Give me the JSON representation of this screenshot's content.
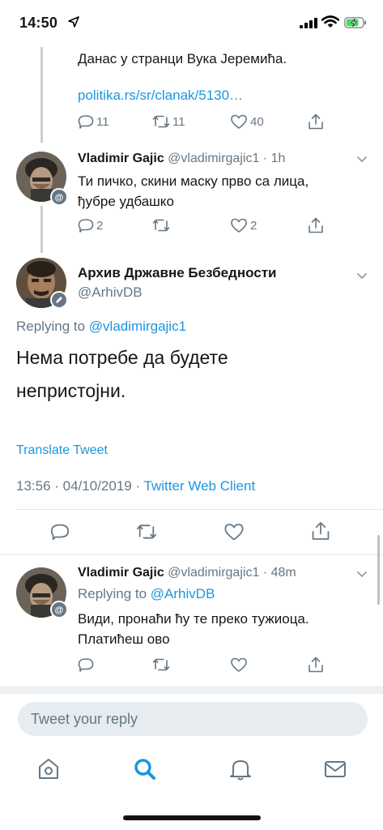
{
  "status": {
    "time": "14:50"
  },
  "tweets": [
    {
      "text": "Данас у странци Вука Јеремића.",
      "link": "politika.rs/sr/clanak/5130…",
      "counts": {
        "reply": "11",
        "retweet": "11",
        "like": "40"
      }
    },
    {
      "name": "Vladimir Gajic",
      "handle": "@vladimirgajic1",
      "time": "· 1h",
      "text_line1": "Ти пичко, скини маску прво са лица,",
      "text_line2": "ђубре удбашко",
      "counts": {
        "reply": "2",
        "like": "2"
      }
    },
    {
      "name": "Архив Државне Безбедности",
      "handle": "@ArhivDB",
      "replying_prefix": "Replying to",
      "replying_to": "@vladimirgajic1",
      "text_line1": "Нема потребе да будете",
      "text_line2": "непристојни.",
      "translate": "Translate Tweet",
      "timestamp": "13:56 · 04/10/2019 ·",
      "source": "Twitter Web Client"
    },
    {
      "name": "Vladimir Gajic",
      "handle": "@vladimirgajic1",
      "time": "· 48m",
      "replying_prefix": "Replying to",
      "replying_to": "@ArhivDB",
      "text_line1": "Види, пронаћи ћу те преко тужиоца.",
      "text_line2": "Платићеш ово"
    }
  ],
  "compose": {
    "placeholder": "Tweet your reply"
  },
  "colors": {
    "accent": "#1b95e0",
    "muted": "#657786",
    "text": "#14171a"
  },
  "tabbar": [
    "home-icon",
    "search-icon",
    "notifications-icon",
    "messages-icon"
  ]
}
